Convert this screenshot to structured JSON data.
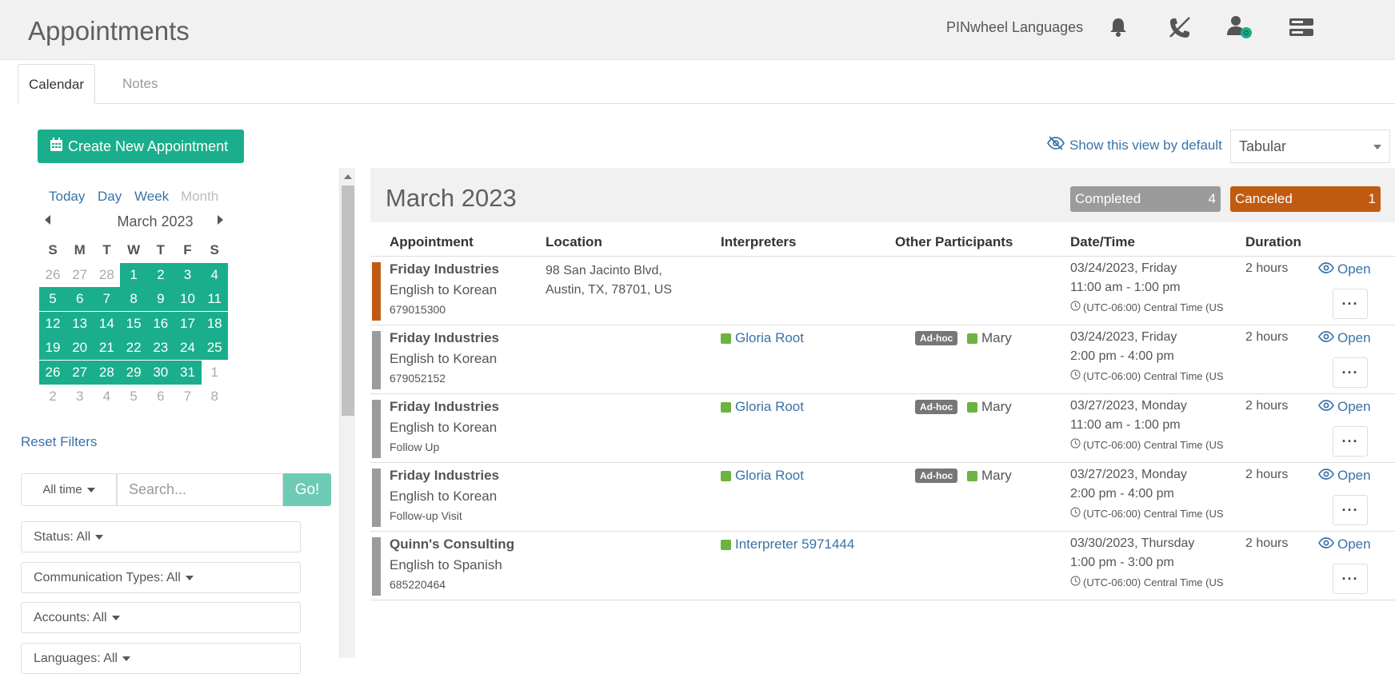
{
  "header": {
    "title": "Appointments",
    "org_name": "PINwheel Languages",
    "icons": [
      "bell-icon",
      "phone-off-icon",
      "user-status-icon",
      "server-icon"
    ]
  },
  "tabs": [
    {
      "label": "Calendar",
      "active": true
    },
    {
      "label": "Notes",
      "active": false
    }
  ],
  "create_button": {
    "label": "Create New Appointment",
    "icon": "calendar-icon"
  },
  "calendar": {
    "nav": {
      "today": "Today",
      "day": "Day",
      "week": "Week",
      "month": "Month"
    },
    "month_label": "March 2023",
    "weekdays": [
      "S",
      "M",
      "T",
      "W",
      "T",
      "F",
      "S"
    ],
    "weeks": [
      [
        {
          "d": "26",
          "cur": false
        },
        {
          "d": "27",
          "cur": false
        },
        {
          "d": "28",
          "cur": false
        },
        {
          "d": "1",
          "cur": true
        },
        {
          "d": "2",
          "cur": true
        },
        {
          "d": "3",
          "cur": true
        },
        {
          "d": "4",
          "cur": true
        }
      ],
      [
        {
          "d": "5",
          "cur": true
        },
        {
          "d": "6",
          "cur": true
        },
        {
          "d": "7",
          "cur": true
        },
        {
          "d": "8",
          "cur": true
        },
        {
          "d": "9",
          "cur": true
        },
        {
          "d": "10",
          "cur": true
        },
        {
          "d": "11",
          "cur": true
        }
      ],
      [
        {
          "d": "12",
          "cur": true
        },
        {
          "d": "13",
          "cur": true
        },
        {
          "d": "14",
          "cur": true
        },
        {
          "d": "15",
          "cur": true
        },
        {
          "d": "16",
          "cur": true
        },
        {
          "d": "17",
          "cur": true
        },
        {
          "d": "18",
          "cur": true
        }
      ],
      [
        {
          "d": "19",
          "cur": true
        },
        {
          "d": "20",
          "cur": true
        },
        {
          "d": "21",
          "cur": true
        },
        {
          "d": "22",
          "cur": true
        },
        {
          "d": "23",
          "cur": true
        },
        {
          "d": "24",
          "cur": true
        },
        {
          "d": "25",
          "cur": true
        }
      ],
      [
        {
          "d": "26",
          "cur": true
        },
        {
          "d": "27",
          "cur": true
        },
        {
          "d": "28",
          "cur": true
        },
        {
          "d": "29",
          "cur": true
        },
        {
          "d": "30",
          "cur": true
        },
        {
          "d": "31",
          "cur": true
        },
        {
          "d": "1",
          "cur": false
        }
      ],
      [
        {
          "d": "2",
          "cur": false
        },
        {
          "d": "3",
          "cur": false
        },
        {
          "d": "4",
          "cur": false
        },
        {
          "d": "5",
          "cur": false
        },
        {
          "d": "6",
          "cur": false
        },
        {
          "d": "7",
          "cur": false
        },
        {
          "d": "8",
          "cur": false
        }
      ]
    ]
  },
  "filters": {
    "reset_label": "Reset Filters",
    "time_range": "All time",
    "search_placeholder": "Search...",
    "go_label": "Go!",
    "dropdowns": [
      "Status: All",
      "Communication Types: All",
      "Accounts: All",
      "Languages: All"
    ]
  },
  "view": {
    "show_default_label": "Show this view by default",
    "selected": "Tabular"
  },
  "month_header": {
    "title": "March 2023",
    "completed": {
      "label": "Completed",
      "count": "4"
    },
    "canceled": {
      "label": "Canceled",
      "count": "1"
    }
  },
  "columns": [
    "Appointment",
    "Location",
    "Interpreters",
    "Other Participants",
    "Date/Time",
    "Duration"
  ],
  "open_label": "Open",
  "appointments": [
    {
      "account": "Friday Industries",
      "language": "English to Korean",
      "ref": "679015300",
      "status": "canceled",
      "location_line1": "98 San Jacinto Blvd,",
      "location_line2": "Austin, TX, 78701, US",
      "interpreter": "",
      "adhoc": "",
      "participant": "",
      "date": "03/24/2023, Friday",
      "time": "11:00 am - 1:00 pm",
      "tz": "(UTC-06:00) Central Time (US",
      "duration": "2 hours"
    },
    {
      "account": "Friday Industries",
      "language": "English to Korean",
      "ref": "679052152",
      "status": "completed",
      "location_line1": "",
      "location_line2": "",
      "interpreter": "Gloria Root",
      "adhoc": "Ad-hoc",
      "participant": "Mary",
      "date": "03/24/2023, Friday",
      "time": "2:00 pm - 4:00 pm",
      "tz": "(UTC-06:00) Central Time (US",
      "duration": "2 hours"
    },
    {
      "account": "Friday Industries",
      "language": "English to Korean",
      "ref": "Follow Up",
      "status": "completed",
      "location_line1": "",
      "location_line2": "",
      "interpreter": "Gloria Root",
      "adhoc": "Ad-hoc",
      "participant": "Mary",
      "date": "03/27/2023, Monday",
      "time": "11:00 am - 1:00 pm",
      "tz": "(UTC-06:00) Central Time (US",
      "duration": "2 hours"
    },
    {
      "account": "Friday Industries",
      "language": "English to Korean",
      "ref": "Follow-up Visit",
      "status": "completed",
      "location_line1": "",
      "location_line2": "",
      "interpreter": "Gloria Root",
      "adhoc": "Ad-hoc",
      "participant": "Mary",
      "date": "03/27/2023, Monday",
      "time": "2:00 pm - 4:00 pm",
      "tz": "(UTC-06:00) Central Time (US",
      "duration": "2 hours"
    },
    {
      "account": "Quinn's Consulting",
      "language": "English to Spanish",
      "ref": "685220464",
      "status": "completed",
      "location_line1": "",
      "location_line2": "",
      "interpreter": "Interpreter 5971444",
      "adhoc": "",
      "participant": "",
      "date": "03/30/2023, Thursday",
      "time": "1:00 pm - 3:00 pm",
      "tz": "(UTC-06:00) Central Time (US",
      "duration": "2 hours"
    }
  ],
  "colors": {
    "accent": "#1aae8c",
    "link": "#3a72a8",
    "canceled": "#c15b12",
    "completed": "#9b9b9b",
    "interpreter_dot": "#6db33f"
  }
}
